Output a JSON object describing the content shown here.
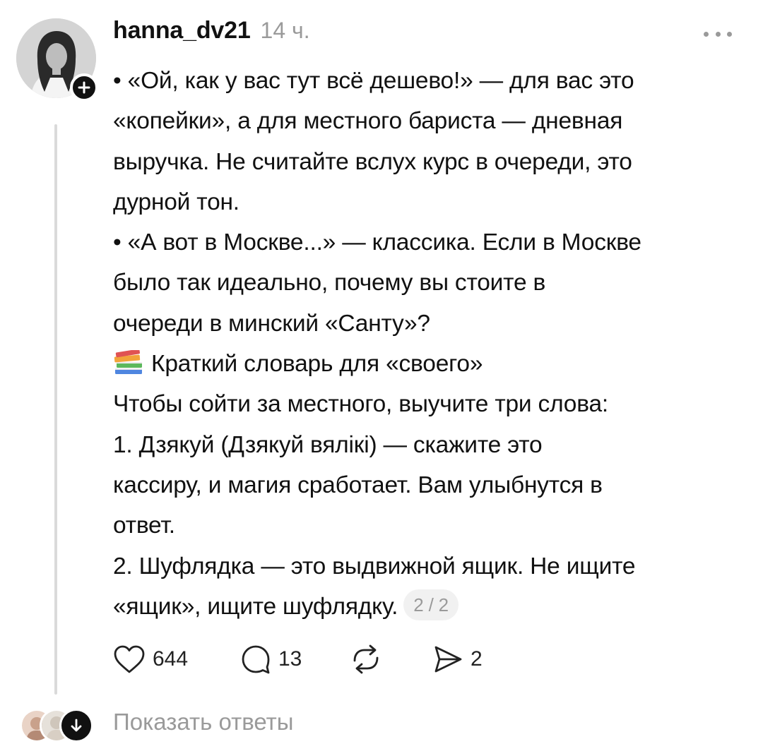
{
  "post": {
    "author": {
      "username": "hanna_dv21",
      "time": "14 ч."
    },
    "icons": {
      "more": "more-dots-icon",
      "follow": "plus-icon",
      "books": "books-emoji-icon"
    },
    "lines": [
      "• «Ой, как у вас тут всё дешево!» — для вас это",
      "«копейки», а для местного бариста — дневная",
      "выручка. Не считайте вслух курс в очереди, это",
      "дурной тон.",
      "• «А вот в Москве...» — классика. Если в Москве",
      "было так идеально, почему вы стоите в",
      "очереди в минский «Санту»?",
      "Краткий словарь для «своего»",
      "Чтобы сойти за местного, выучите три слова:",
      "1. Дзякуй (Дзякуй вялікі) — скажите это",
      "кассиру, и магия сработает. Вам улыбнутся в",
      "ответ.",
      "2. Шуфлядка — это выдвижной ящик. Не ищите",
      "«ящик», ищите шуфлядку."
    ],
    "page_indicator": "2 / 2",
    "actions": {
      "like": {
        "icon": "heart-icon",
        "count": "644"
      },
      "comment": {
        "icon": "comment-icon",
        "count": "13"
      },
      "repost": {
        "icon": "repost-icon",
        "count": ""
      },
      "share": {
        "icon": "send-icon",
        "count": "2"
      }
    },
    "replies": {
      "label": "Показать ответы",
      "icon": "arrow-down-icon"
    }
  }
}
